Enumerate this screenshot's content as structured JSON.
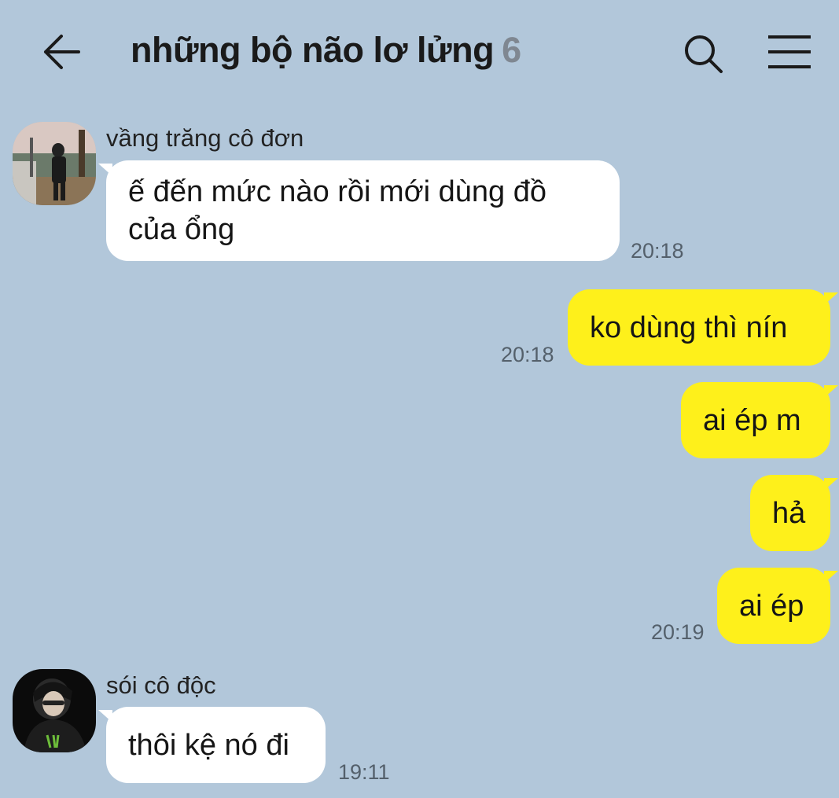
{
  "header": {
    "title": "những bộ não lơ lửng",
    "member_count": "6",
    "back_icon": "back-arrow-icon",
    "search_icon": "search-icon",
    "menu_icon": "hamburger-menu-icon"
  },
  "messages": [
    {
      "sender": "vầng trăng cô đơn",
      "lines": [
        "ế đến mức nào rồi mới dùng đồ",
        "của ổng"
      ],
      "time": "20:18",
      "direction": "incoming"
    },
    {
      "text": "ko dùng thì nín",
      "time": "20:18",
      "direction": "outgoing"
    },
    {
      "text": "ai ép m",
      "direction": "outgoing"
    },
    {
      "text": "hả",
      "direction": "outgoing"
    },
    {
      "text": "ai ép",
      "time": "20:19",
      "direction": "outgoing"
    },
    {
      "sender": "sói cô độc",
      "text": "thôi kệ nó đi",
      "time": "19:11",
      "direction": "incoming"
    }
  ],
  "colors": {
    "background": "#b2c7da",
    "incoming_bubble": "#ffffff",
    "outgoing_bubble": "#fef01b",
    "count_text": "#7f8791"
  }
}
